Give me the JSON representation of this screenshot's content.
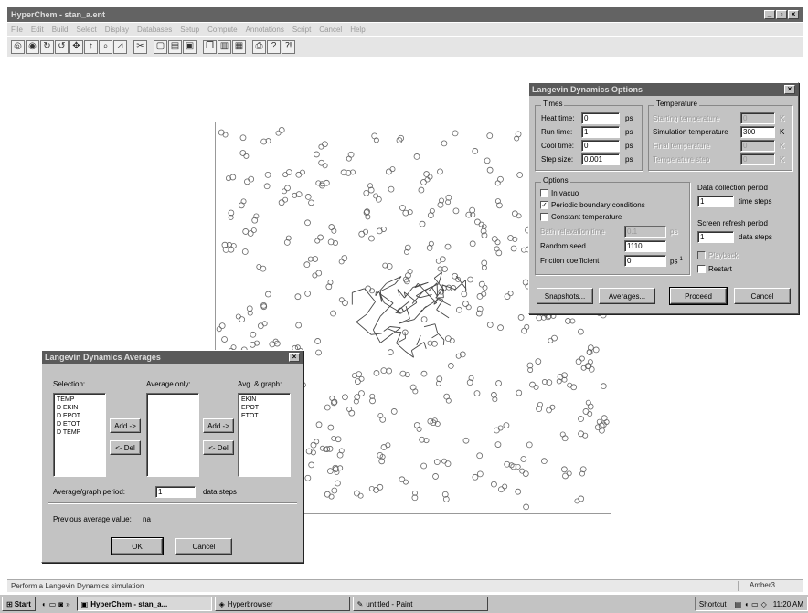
{
  "app": {
    "title": "HyperChem - stan_a.ent",
    "menu": [
      "File",
      "Edit",
      "Build",
      "Select",
      "Display",
      "Databases",
      "Setup",
      "Compute",
      "Annotations",
      "Script",
      "Cancel",
      "Help"
    ]
  },
  "status": {
    "message": "Perform a Langevin Dynamics simulation",
    "right": "Amber3"
  },
  "taskbar": {
    "start": "Start",
    "tasks": [
      "HyperChem - stan_a...",
      "Hyperbrowser",
      "untitled - Paint"
    ],
    "tray_label": "Shortcut",
    "clock": "11:20 AM"
  },
  "options_dialog": {
    "title": "Langevin Dynamics Options",
    "times": {
      "group": "Times",
      "heat_time_label": "Heat time:",
      "heat_time": "0",
      "run_time_label": "Run time:",
      "run_time": "1",
      "cool_time_label": "Cool time:",
      "cool_time": "0",
      "step_size_label": "Step size:",
      "step_size": "0.001",
      "unit": "ps"
    },
    "temperature": {
      "group": "Temperature",
      "starting_label": "Starting temperature",
      "starting": "0",
      "simulation_label": "Simulation temperature",
      "simulation": "300",
      "final_label": "Final temperature",
      "final": "0",
      "step_label": "Temperature step",
      "step": "0",
      "unit": "K"
    },
    "options": {
      "group": "Options",
      "in_vacuo": "In vacuo",
      "periodic": "Periodic boundary conditions",
      "constant_temp": "Constant temperature",
      "bath_relax_label": "Bath relaxation time",
      "bath_relax": "0.1",
      "bath_unit": "ps",
      "random_seed_label": "Random seed",
      "random_seed": "1110",
      "friction_label": "Friction coefficient",
      "friction": "0",
      "friction_unit": "ps",
      "friction_exp": "-1"
    },
    "data_collection": {
      "label": "Data collection period",
      "value": "1",
      "unit": "time steps"
    },
    "screen_refresh": {
      "label": "Screen refresh period",
      "value": "1",
      "unit": "data steps"
    },
    "playback": "Playback",
    "restart": "Restart",
    "buttons": {
      "snapshots": "Snapshots...",
      "averages": "Averages...",
      "proceed": "Proceed",
      "cancel": "Cancel"
    }
  },
  "averages_dialog": {
    "title": "Langevin Dynamics Averages",
    "selection_label": "Selection:",
    "selection_items": [
      "TEMP",
      "D EKIN",
      "D EPOT",
      "D ETOT",
      "D TEMP"
    ],
    "average_only_label": "Average only:",
    "average_only_items": [],
    "avg_graph_label": "Avg. & graph:",
    "avg_graph_items": [
      "EKIN",
      "EPOT",
      "ETOT"
    ],
    "add_label": "Add ->",
    "del_label": "<- Del",
    "period_label": "Average/graph period:",
    "period_value": "1",
    "period_unit": "data steps",
    "previous_label": "Previous average value:",
    "previous_value": "na",
    "ok": "OK",
    "cancel": "Cancel"
  }
}
